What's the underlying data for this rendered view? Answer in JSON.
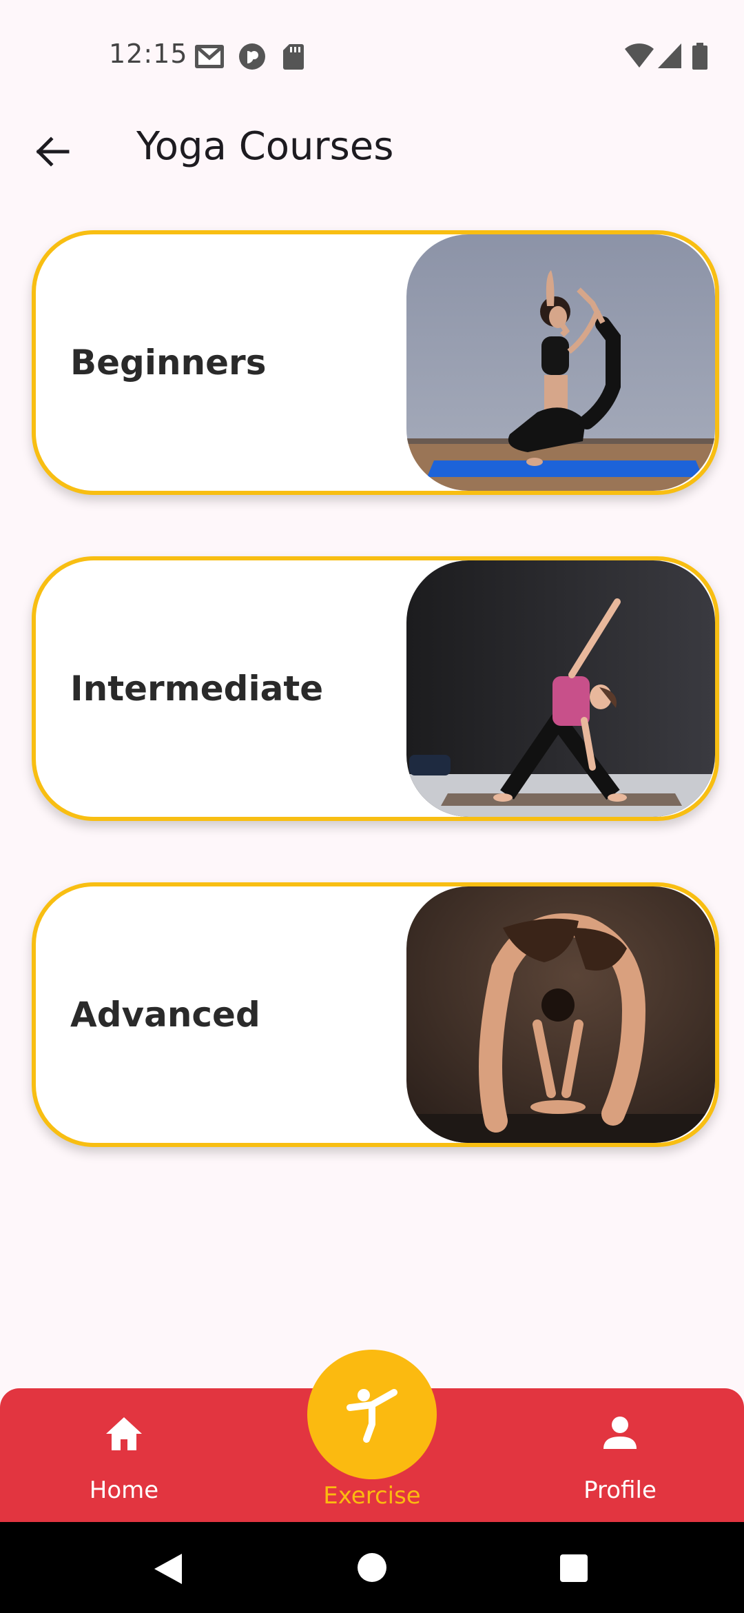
{
  "status_bar": {
    "time": "12:15",
    "left_icons": [
      "gmail-icon",
      "pocket-casts-icon",
      "sd-card-icon"
    ],
    "right_icons": [
      "wifi-icon",
      "signal-icon",
      "battery-icon"
    ]
  },
  "app_bar": {
    "back_icon": "arrow-left-icon",
    "title": "Yoga Courses"
  },
  "courses": [
    {
      "label": "Beginners"
    },
    {
      "label": "Intermediate"
    },
    {
      "label": "Advanced"
    }
  ],
  "bottom_nav": {
    "items": [
      {
        "label": "Home",
        "icon": "home-icon"
      },
      {
        "label": "Exercise",
        "icon": "exercise-icon"
      },
      {
        "label": "Profile",
        "icon": "person-icon"
      }
    ],
    "selected": "Exercise"
  },
  "colors": {
    "accent": "#F8BE12",
    "nav_background": "#E23540",
    "page_background": "#FEF7FA",
    "selected_label": "#FBBA10",
    "label_text": "#FFFFFF"
  },
  "system_nav": [
    "back-triangle-icon",
    "home-circle-icon",
    "recents-square-icon"
  ]
}
